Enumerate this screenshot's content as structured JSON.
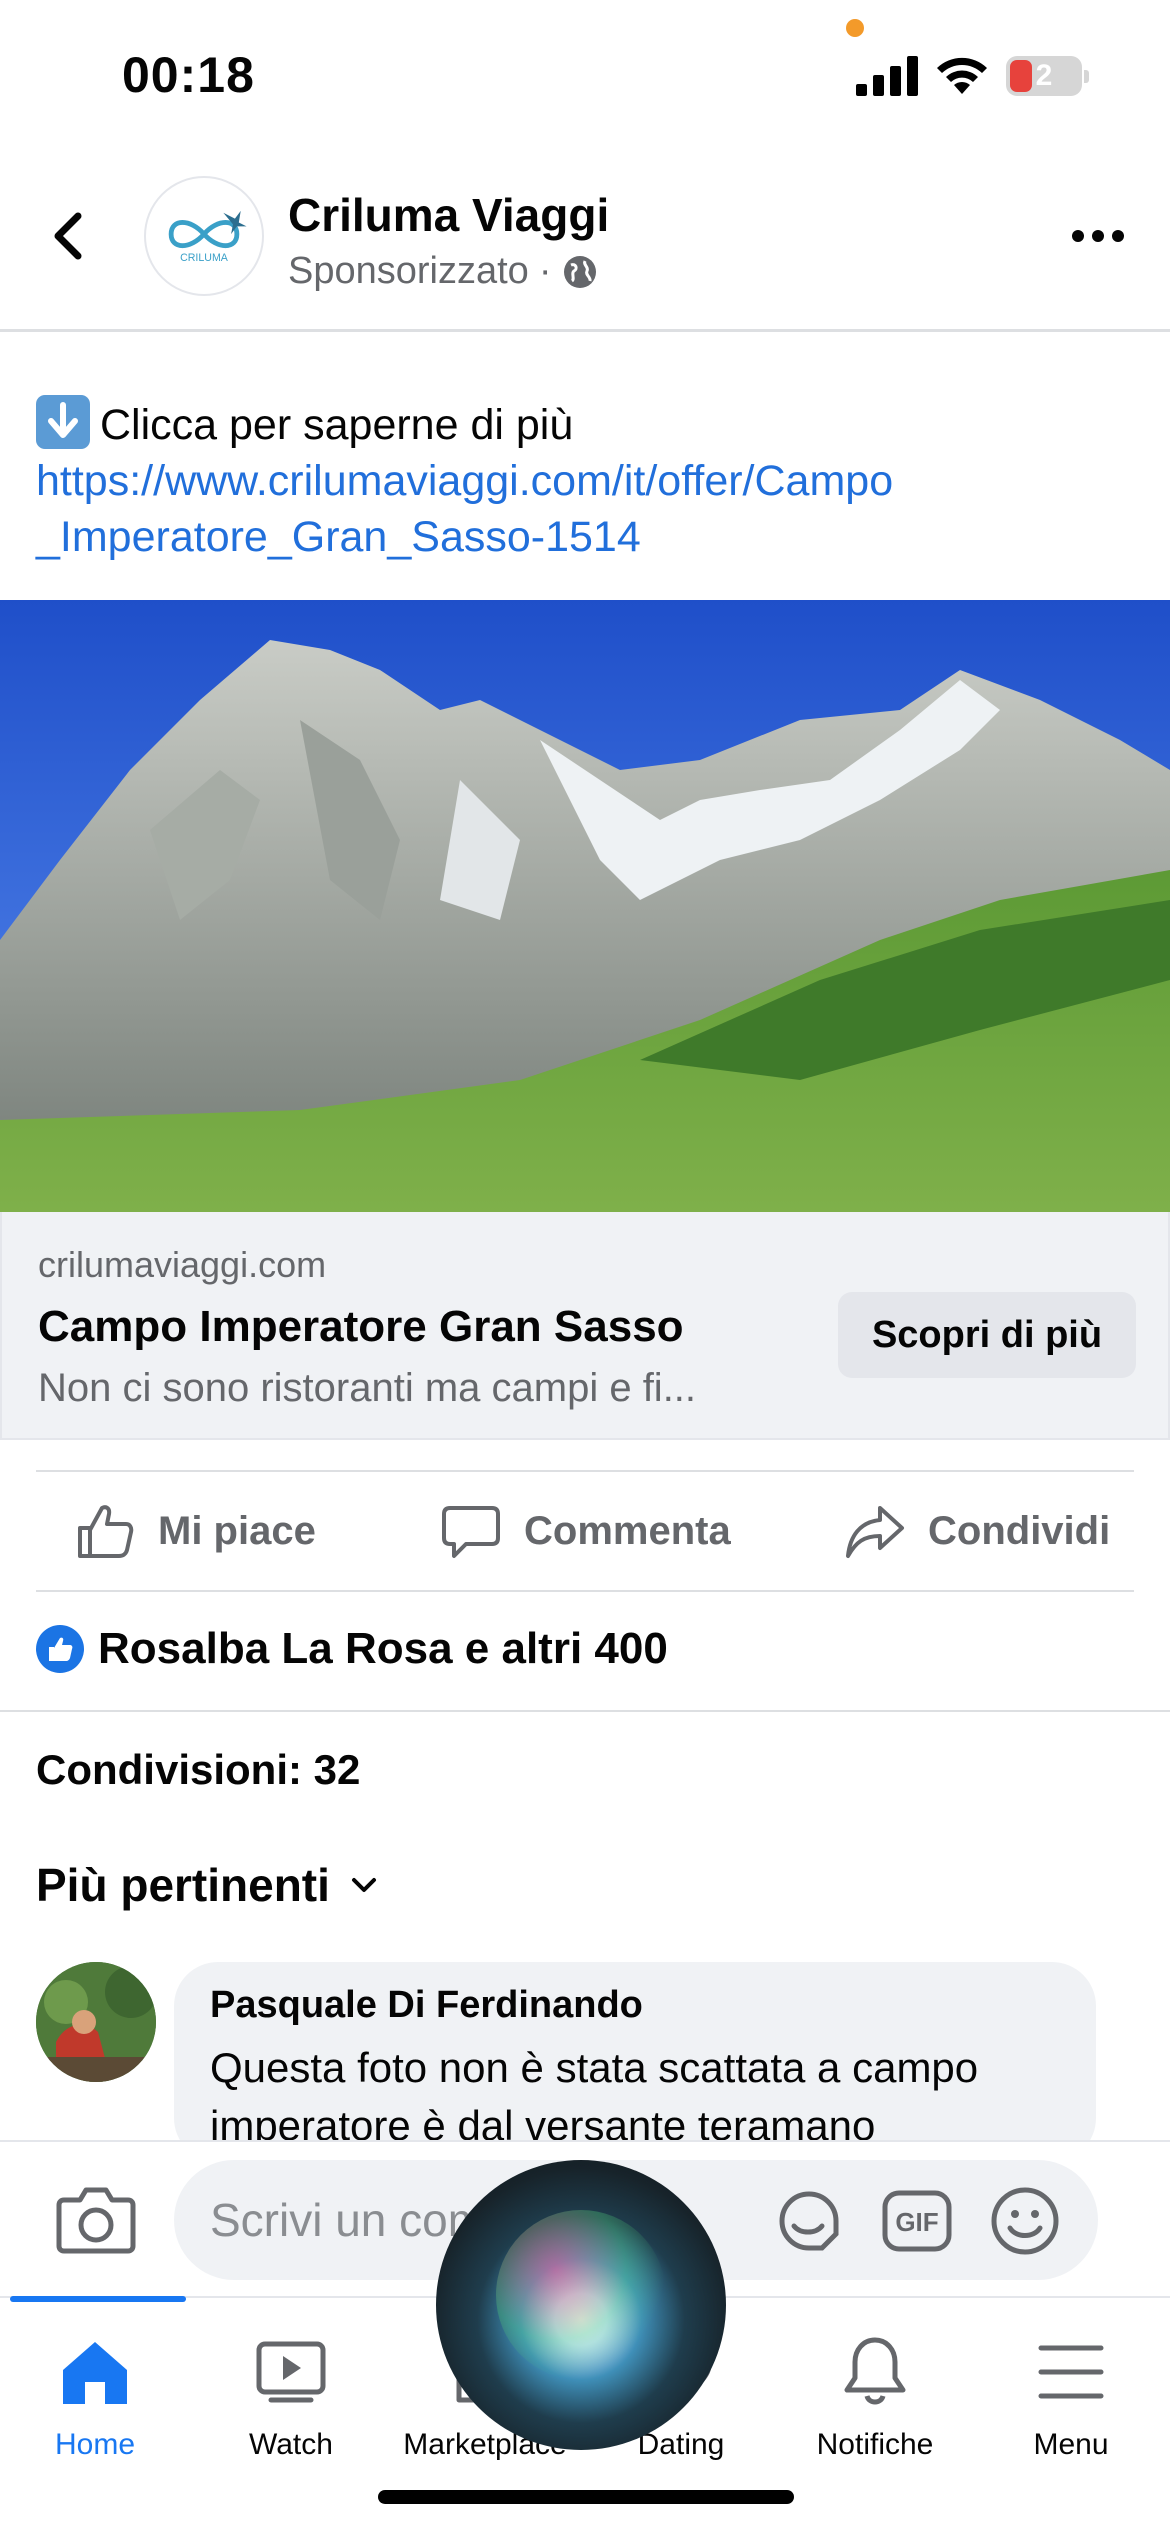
{
  "status_bar": {
    "time": "00:18",
    "battery": "2"
  },
  "post": {
    "page_name": "Criluma Viaggi",
    "sponsored": "Sponsorizzato",
    "sponsored_sep": "·",
    "text_line": "Clicca per saperne di più",
    "link": "https://www.crilumaviaggi.com/it/offer/Campo_Imperatore_Gran_Sasso-1514",
    "logo_text": "CRILUMA"
  },
  "link_preview": {
    "domain": "crilumaviaggi.com",
    "title": "Campo Imperatore Gran Sasso",
    "description": "Non ci sono ristoranti ma campi e fi...",
    "cta_label": "Scopri di più"
  },
  "actions": {
    "like": "Mi piace",
    "comment": "Commenta",
    "share": "Condividi"
  },
  "reactions": {
    "text": "Rosalba La Rosa e altri 400"
  },
  "shares": "Condivisioni: 32",
  "sort": {
    "label": "Più pertinenti"
  },
  "comment": {
    "author": "Pasquale Di Ferdinando",
    "text": "Questa foto non è stata scattata a campo imperatore è dal versante teramano"
  },
  "composer": {
    "placeholder": "Scrivi un commento..."
  },
  "tabbar": {
    "home": "Home",
    "watch": "Watch",
    "marketplace": "Marketplace",
    "dating": "Dating",
    "notifications": "Notifiche",
    "menu": "Menu"
  },
  "colors": {
    "brand_blue": "#1877f2",
    "link_blue": "#216fdb",
    "secondary_text": "#65676b"
  }
}
